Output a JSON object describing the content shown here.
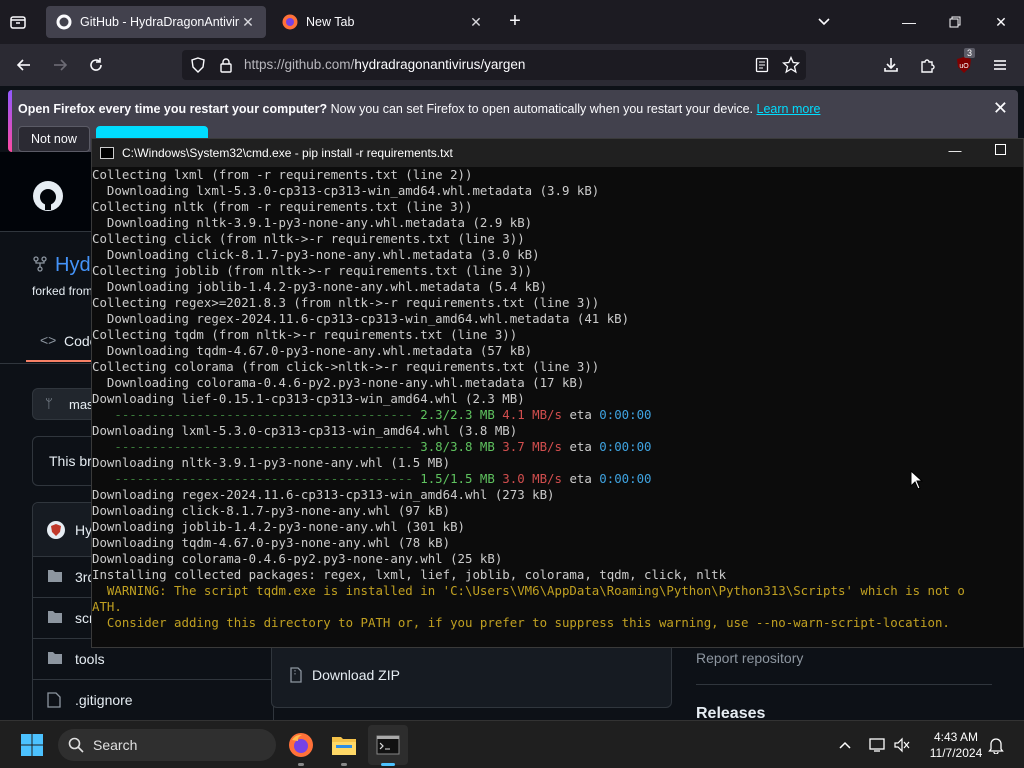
{
  "browser": {
    "tabs": [
      {
        "title": "GitHub - HydraDragonAntivirus",
        "active": true
      },
      {
        "title": "New Tab",
        "active": false
      }
    ],
    "url_host": "https://github.com/",
    "url_path": "hydradragonantivirus/yargen",
    "extension_badge": "3",
    "notice": {
      "bold": "Open Firefox every time you restart your computer?",
      "text": " Now you can set Firefox to open automatically when you restart your device.",
      "link": "Learn more",
      "not_now": "Not now"
    }
  },
  "github": {
    "repo_name": "Hyd",
    "forked_from": "forked from",
    "code_tab": "Code",
    "branch": "mas",
    "banner": "This br",
    "latest_commit_author": "Hy",
    "files": [
      {
        "name": "3rd",
        "type": "folder"
      },
      {
        "name": "scr",
        "type": "folder"
      },
      {
        "name": "tools",
        "type": "folder"
      },
      {
        "name": ".gitignore",
        "type": "file"
      }
    ],
    "download_zip": "Download ZIP",
    "report_repository": "Report repository",
    "releases": "Releases"
  },
  "cmd": {
    "title": "C:\\Windows\\System32\\cmd.exe - pip  install -r requirements.txt",
    "lines": [
      {
        "segs": [
          {
            "t": "Collecting lxml (from -r requirements.txt (line 2))",
            "c": ""
          }
        ]
      },
      {
        "segs": [
          {
            "t": "  Downloading lxml-5.3.0-cp313-cp313-win_amd64.whl.metadata (3.9 kB)",
            "c": ""
          }
        ]
      },
      {
        "segs": [
          {
            "t": "Collecting nltk (from -r requirements.txt (line 3))",
            "c": ""
          }
        ]
      },
      {
        "segs": [
          {
            "t": "  Downloading nltk-3.9.1-py3-none-any.whl.metadata (2.9 kB)",
            "c": ""
          }
        ]
      },
      {
        "segs": [
          {
            "t": "Collecting click (from nltk->-r requirements.txt (line 3))",
            "c": ""
          }
        ]
      },
      {
        "segs": [
          {
            "t": "  Downloading click-8.1.7-py3-none-any.whl.metadata (3.0 kB)",
            "c": ""
          }
        ]
      },
      {
        "segs": [
          {
            "t": "Collecting joblib (from nltk->-r requirements.txt (line 3))",
            "c": ""
          }
        ]
      },
      {
        "segs": [
          {
            "t": "  Downloading joblib-1.4.2-py3-none-any.whl.metadata (5.4 kB)",
            "c": ""
          }
        ]
      },
      {
        "segs": [
          {
            "t": "Collecting regex>=2021.8.3 (from nltk->-r requirements.txt (line 3))",
            "c": ""
          }
        ]
      },
      {
        "segs": [
          {
            "t": "  Downloading regex-2024.11.6-cp313-cp313-win_amd64.whl.metadata (41 kB)",
            "c": ""
          }
        ]
      },
      {
        "segs": [
          {
            "t": "Collecting tqdm (from nltk->-r requirements.txt (line 3))",
            "c": ""
          }
        ]
      },
      {
        "segs": [
          {
            "t": "  Downloading tqdm-4.67.0-py3-none-any.whl.metadata (57 kB)",
            "c": ""
          }
        ]
      },
      {
        "segs": [
          {
            "t": "Collecting colorama (from click->nltk->-r requirements.txt (line 3))",
            "c": ""
          }
        ]
      },
      {
        "segs": [
          {
            "t": "  Downloading colorama-0.4.6-py2.py3-none-any.whl.metadata (17 kB)",
            "c": ""
          }
        ]
      },
      {
        "segs": [
          {
            "t": "Downloading lief-0.15.1-cp313-cp313-win_amd64.whl (2.3 MB)",
            "c": ""
          }
        ]
      },
      {
        "segs": [
          {
            "t": "   ---------------------------------------- ",
            "c": "dash"
          },
          {
            "t": "2.3/2.3 MB",
            "c": "g"
          },
          {
            "t": " 4.1 MB/s",
            "c": "r"
          },
          {
            "t": " eta ",
            "c": ""
          },
          {
            "t": "0:00:00",
            "c": "c"
          }
        ]
      },
      {
        "segs": [
          {
            "t": "Downloading lxml-5.3.0-cp313-cp313-win_amd64.whl (3.8 MB)",
            "c": ""
          }
        ]
      },
      {
        "segs": [
          {
            "t": "   ---------------------------------------- ",
            "c": "dash"
          },
          {
            "t": "3.8/3.8 MB",
            "c": "g"
          },
          {
            "t": " 3.7 MB/s",
            "c": "r"
          },
          {
            "t": " eta ",
            "c": ""
          },
          {
            "t": "0:00:00",
            "c": "c"
          }
        ]
      },
      {
        "segs": [
          {
            "t": "Downloading nltk-3.9.1-py3-none-any.whl (1.5 MB)",
            "c": ""
          }
        ]
      },
      {
        "segs": [
          {
            "t": "   ---------------------------------------- ",
            "c": "dash"
          },
          {
            "t": "1.5/1.5 MB",
            "c": "g"
          },
          {
            "t": " 3.0 MB/s",
            "c": "r"
          },
          {
            "t": " eta ",
            "c": ""
          },
          {
            "t": "0:00:00",
            "c": "c"
          }
        ]
      },
      {
        "segs": [
          {
            "t": "Downloading regex-2024.11.6-cp313-cp313-win_amd64.whl (273 kB)",
            "c": ""
          }
        ]
      },
      {
        "segs": [
          {
            "t": "Downloading click-8.1.7-py3-none-any.whl (97 kB)",
            "c": ""
          }
        ]
      },
      {
        "segs": [
          {
            "t": "Downloading joblib-1.4.2-py3-none-any.whl (301 kB)",
            "c": ""
          }
        ]
      },
      {
        "segs": [
          {
            "t": "Downloading tqdm-4.67.0-py3-none-any.whl (78 kB)",
            "c": ""
          }
        ]
      },
      {
        "segs": [
          {
            "t": "Downloading colorama-0.4.6-py2.py3-none-any.whl (25 kB)",
            "c": ""
          }
        ]
      },
      {
        "segs": [
          {
            "t": "Installing collected packages: regex, lxml, lief, joblib, colorama, tqdm, click, nltk",
            "c": ""
          }
        ]
      },
      {
        "segs": [
          {
            "t": "  WARNING: The script tqdm.exe is installed in 'C:\\Users\\VM6\\AppData\\Roaming\\Python\\Python313\\Scripts' which is not o",
            "c": "y"
          }
        ]
      },
      {
        "segs": [
          {
            "t": "ATH.",
            "c": "y"
          }
        ]
      },
      {
        "segs": [
          {
            "t": "  Consider adding this directory to PATH or, if you prefer to suppress this warning, use --no-warn-script-location.",
            "c": "y"
          }
        ]
      }
    ]
  },
  "taskbar": {
    "search_label": "Search",
    "time": "4:43 AM",
    "date": "11/7/2024"
  },
  "colors": {
    "accent_link": "#00ddff",
    "warning_text": "#c0a021",
    "progress_green": "#5fc35f",
    "speed_red": "#d24e4e",
    "eta_cyan": "#3fa3e0"
  }
}
